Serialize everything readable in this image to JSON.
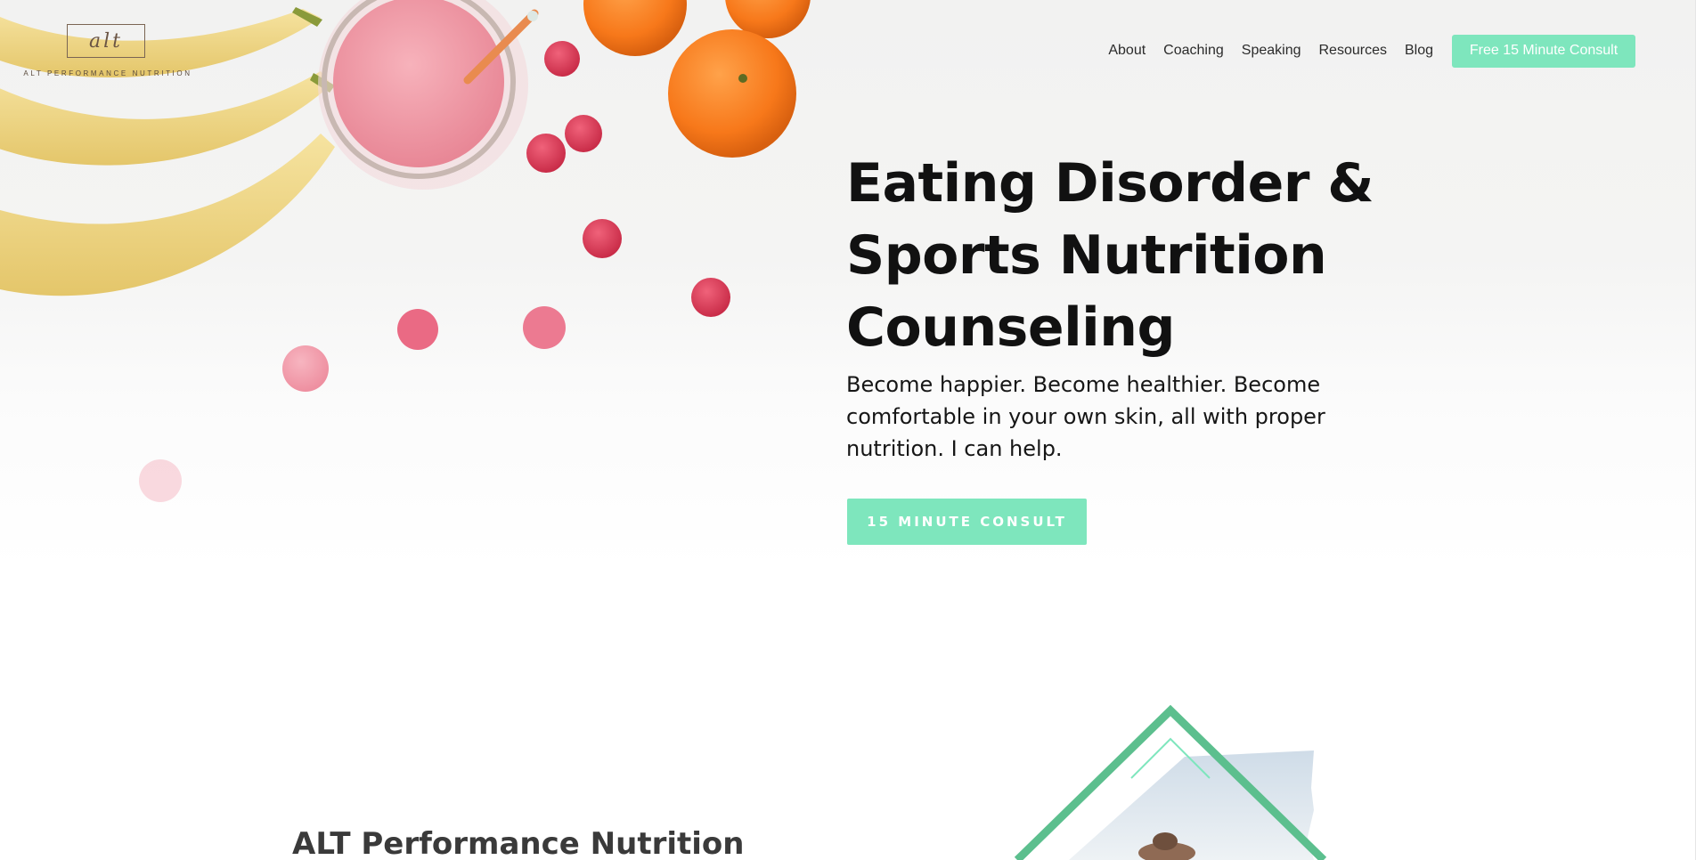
{
  "brand": {
    "logo_mark": "alt",
    "logo_caption": "ALT PERFORMANCE NUTRITION"
  },
  "nav": {
    "items": [
      {
        "label": "About"
      },
      {
        "label": "Coaching"
      },
      {
        "label": "Speaking"
      },
      {
        "label": "Resources"
      },
      {
        "label": "Blog"
      }
    ],
    "cta_label": "Free 15 Minute Consult"
  },
  "hero": {
    "title": "Eating Disorder & Sports Nutrition Counseling",
    "subtitle": "Become happier. Become healthier. Become comfortable in your own skin, all with proper nutrition. I can help.",
    "button_label": "15 MINUTE CONSULT",
    "image_icon": "fruit-smoothie-photo"
  },
  "about": {
    "title": "ALT Performance Nutrition",
    "graphic_icon": "diamond-frame-photo"
  },
  "colors": {
    "accent": "#7ee6bd",
    "accent_dark": "#5cbf8e",
    "text_dark": "#111111",
    "heading_gray": "#3a3a3a"
  }
}
